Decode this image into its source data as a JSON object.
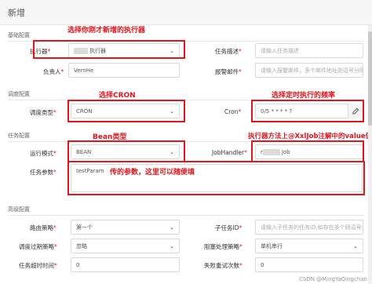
{
  "dialog": {
    "title": "新增"
  },
  "sections": {
    "basic": "基础配置",
    "schedule": "调度配置",
    "task": "任务配置",
    "advanced": "高级配置"
  },
  "form": {
    "executor": {
      "label": "执行器",
      "value": "执行器"
    },
    "task_desc": {
      "label": "任务描述",
      "placeholder": "请输入任务描述"
    },
    "owner": {
      "label": "负责人",
      "value": "VernHe"
    },
    "alarm_email": {
      "label": "报警邮件",
      "placeholder": "请输入报警邮件，多个邮件地址则逗号分隔"
    },
    "schedule_type": {
      "label": "调度类型",
      "value": "CRON"
    },
    "cron": {
      "label": "Cron",
      "value": "0/5 * * * * ?"
    },
    "run_mode": {
      "label": "运行模式",
      "value": "BEAN"
    },
    "job_handler": {
      "label": "JobHandler",
      "value_prefix": "r",
      "value_suffix": "Job"
    },
    "task_param": {
      "label": "任务参数",
      "value": "testParam"
    },
    "route_strategy": {
      "label": "路由策略",
      "value": "第一个"
    },
    "child_job": {
      "label": "子任务ID",
      "placeholder": "请输入子任务的任务ID,如存在多个则逗号分隔"
    },
    "expire_strategy": {
      "label": "调度过期策略",
      "value": "忽略"
    },
    "block_strategy": {
      "label": "阻塞处理策略",
      "value": "单机串行"
    },
    "timeout": {
      "label": "任务超时时间",
      "value": "0"
    },
    "retry": {
      "label": "失败重试次数",
      "value": "0"
    }
  },
  "annotations": {
    "executor": "选择你刚才新增的执行器",
    "cron_type": "选择CRON",
    "cron": "选择定时执行的频率",
    "bean": "Bean类型",
    "handler": "执行器方法上@XxlJob注解中的value值",
    "param": "传的参数，这里可以随便填"
  },
  "watermark": "CSDN @MingYaQingchan",
  "colors": {
    "annotation_red": "#e4141b",
    "required": "#e02020"
  }
}
